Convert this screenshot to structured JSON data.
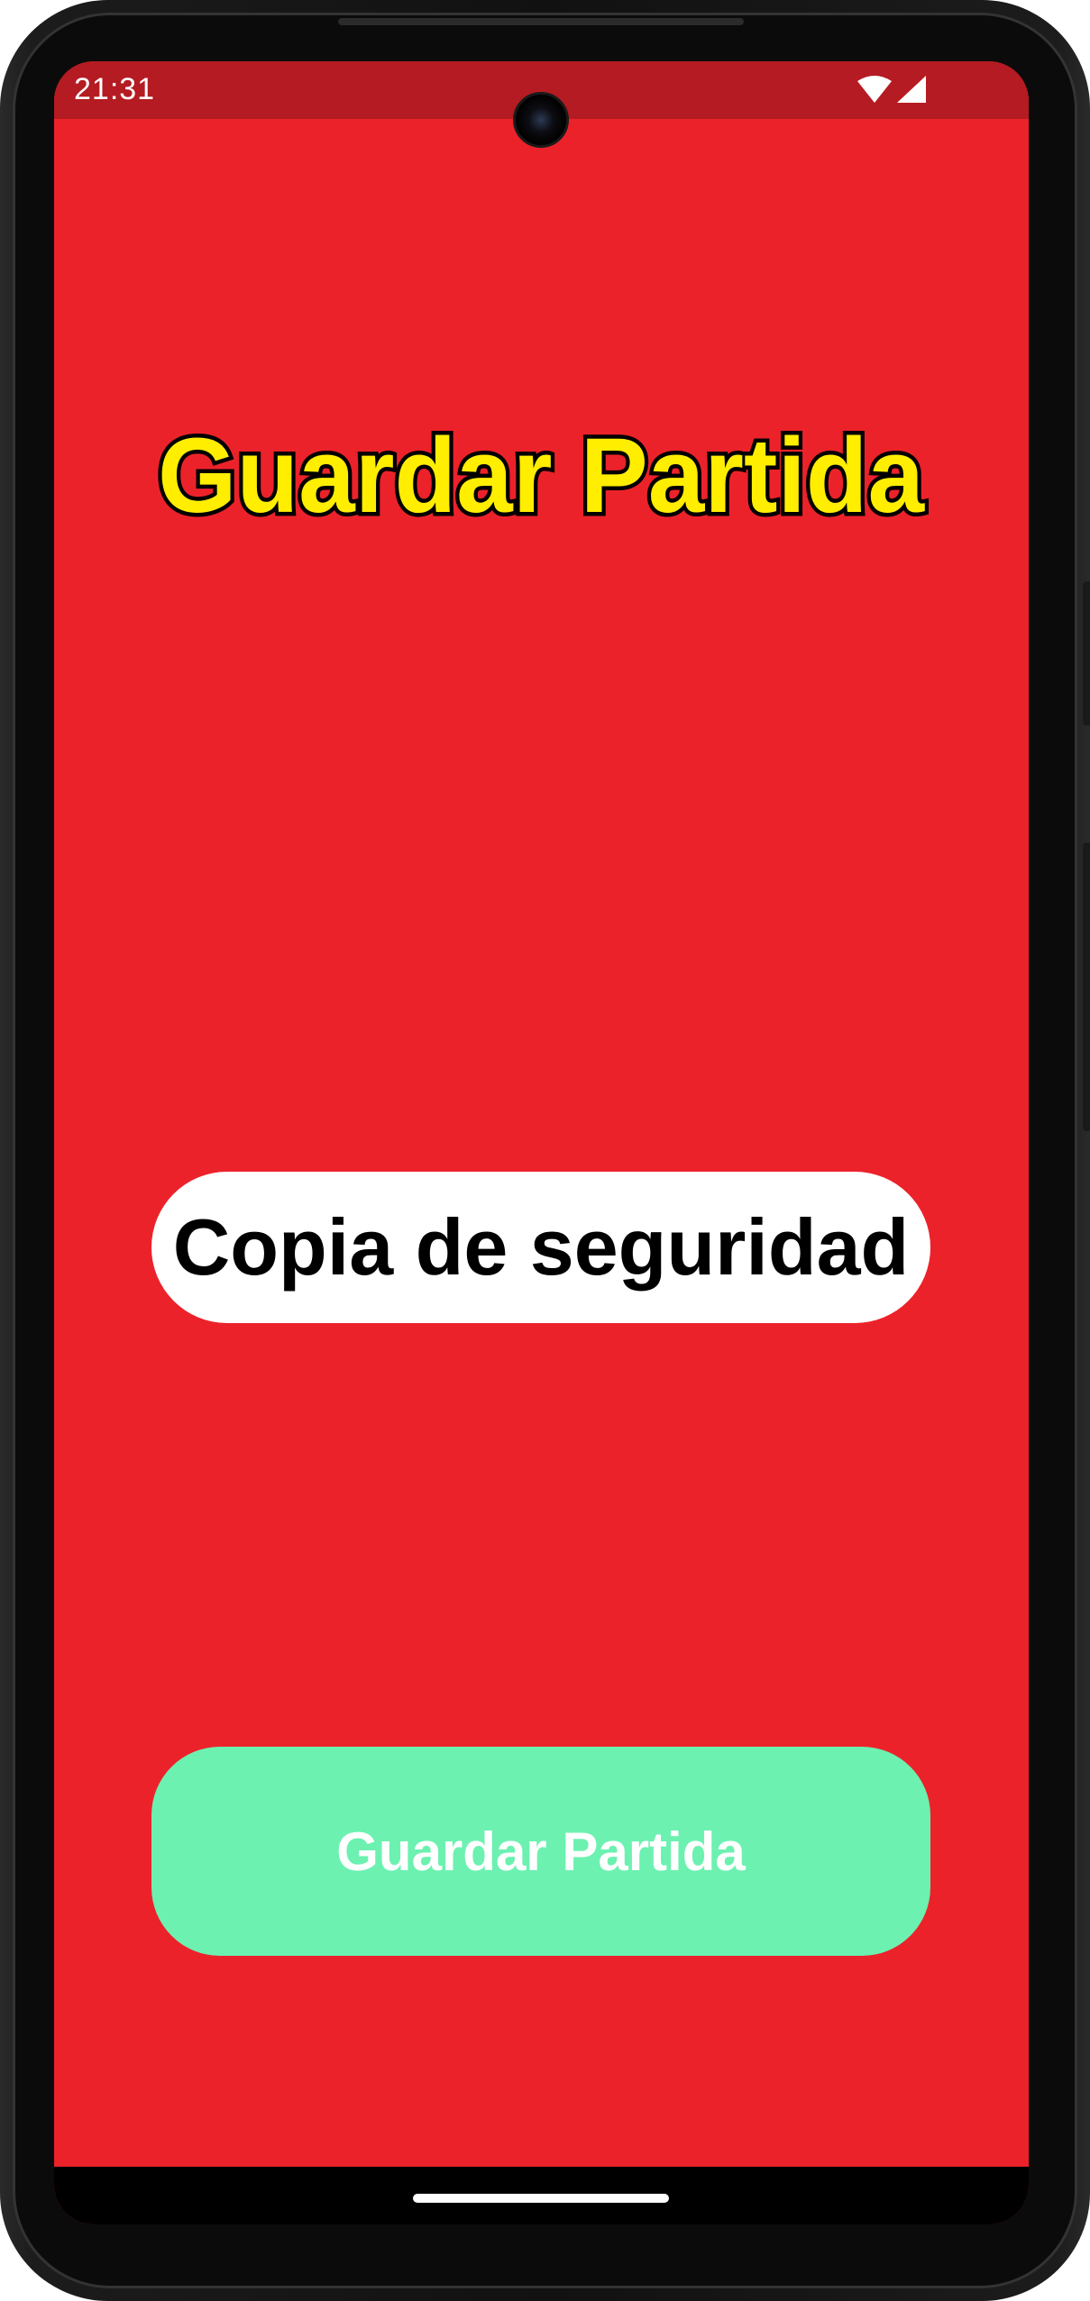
{
  "status_bar": {
    "time": "21:31",
    "icons": [
      "wifi-icon",
      "cellular-signal-icon"
    ]
  },
  "screen": {
    "background_color": "#ec222a",
    "status_bar_color": "#b51b22"
  },
  "header": {
    "title": "Guardar Partida",
    "title_fill_color": "#ffee00",
    "title_outline_color": "#000000"
  },
  "backup_label": {
    "text": "Copia de seguridad"
  },
  "save_button": {
    "label": "Guardar Partida",
    "color": "#6cf1b1"
  },
  "nav_bar": {
    "handle": "home-gesture-handle"
  }
}
